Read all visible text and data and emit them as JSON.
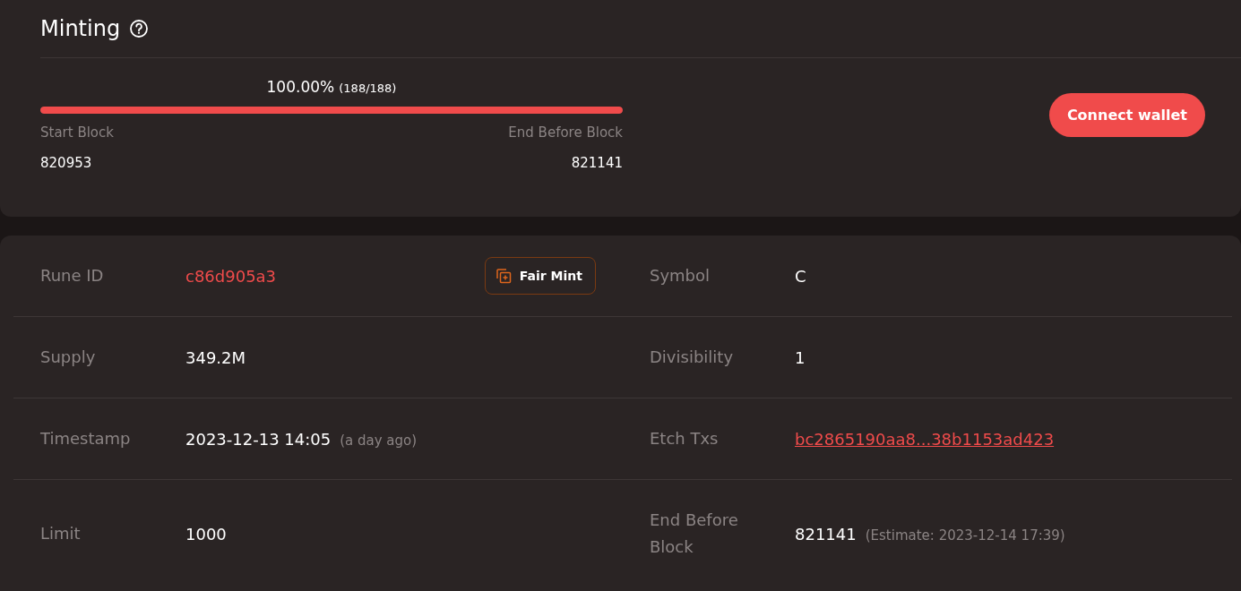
{
  "minting": {
    "title": "Minting",
    "percent": "100.00%",
    "count": "(188/188)",
    "level": 1,
    "start_label": "Start Block",
    "start_value": "820953",
    "end_label": "End Before Block",
    "end_value": "821141",
    "button": "Connect wallet"
  },
  "rows": [
    {
      "cells": [
        {
          "label": "Rune ID",
          "value": "c86d905a3",
          "kind": "accent",
          "action": "Fair Mint"
        },
        {
          "label": "Symbol",
          "value": "C",
          "kind": "plain"
        }
      ]
    },
    {
      "cells": [
        {
          "label": "Supply",
          "value": "349.2M",
          "kind": "plain"
        },
        {
          "label": "Divisibility",
          "value": "1",
          "kind": "plain"
        }
      ]
    },
    {
      "cells": [
        {
          "label": "Timestamp",
          "value": "2023-12-13 14:05",
          "note": "(a day ago)",
          "kind": "plain"
        },
        {
          "label": "Etch Txs",
          "value": "bc2865190aa8...38b1153ad423",
          "kind": "link"
        }
      ]
    },
    {
      "cells": [
        {
          "label": "Limit",
          "value": "1000",
          "kind": "plain"
        },
        {
          "label": "End Before Block",
          "value": "821141",
          "note": "(Estimate: 2023-12-14 17:39)",
          "kind": "plain"
        }
      ]
    }
  ]
}
